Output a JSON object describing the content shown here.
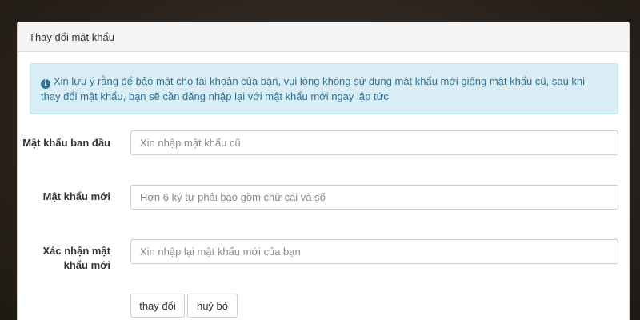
{
  "panel": {
    "title": "Thay đổi mật khẩu"
  },
  "alert": {
    "icon": "info-circle-icon",
    "message": "Xin lưu ý rằng để bảo mật cho tài khoản của bạn, vui lòng không sử dụng mật khẩu mới giống mật khẩu cũ, sau khi thay đổi mật khẩu, bạn sẽ cần đăng nhập lại với mật khẩu mới ngay lập tức"
  },
  "form": {
    "old_password": {
      "label": "Mật khẩu ban đầu",
      "value": "",
      "placeholder": "Xin nhập mật khẩu cũ"
    },
    "new_password": {
      "label": "Mật khẩu mới",
      "value": "",
      "placeholder": "Hơn 6 ký tự phải bao gồm chữ cái và số"
    },
    "confirm_password": {
      "label": "Xác nhận mật khẩu mới",
      "value": "",
      "placeholder": "Xin nhập lại mật khẩu mới của bạn"
    }
  },
  "buttons": {
    "submit_label": "thay đổi",
    "cancel_label": "huỷ bỏ"
  }
}
